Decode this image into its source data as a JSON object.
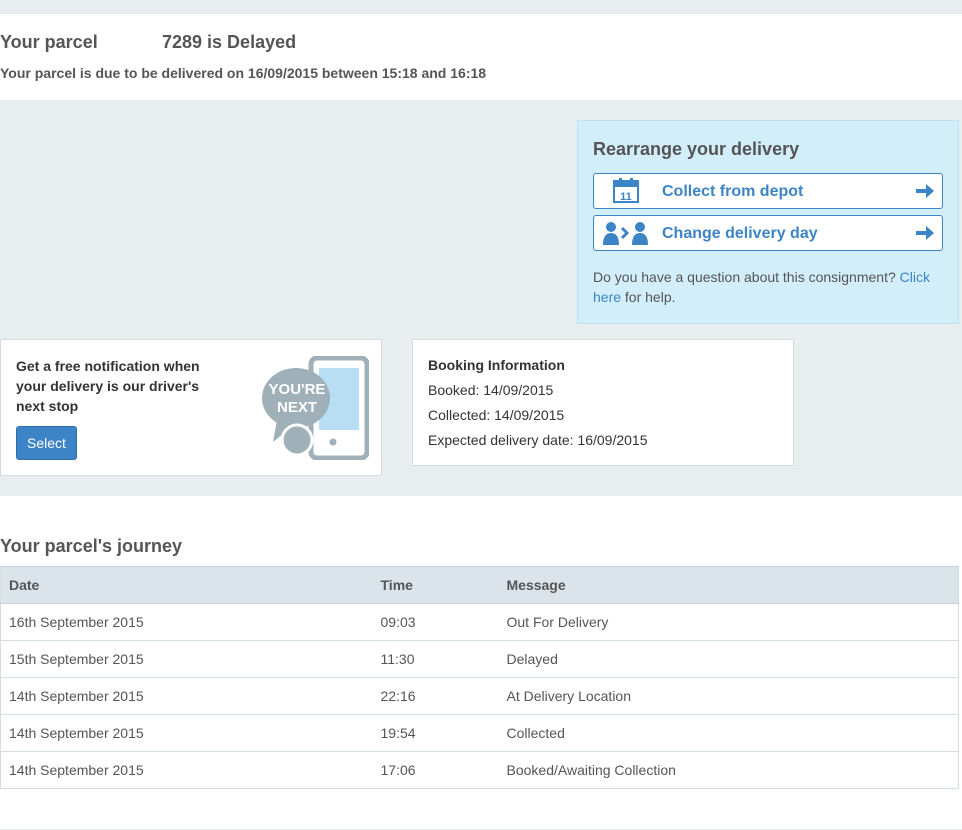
{
  "header": {
    "title_prefix": "Your parcel",
    "title_status": "7289 is Delayed",
    "subtitle": "Your parcel is due to be delivered on 16/09/2015 between 15:18 and 16:18"
  },
  "rearrange": {
    "heading": "Rearrange your delivery",
    "options": [
      {
        "label": "Collect from depot",
        "icon": "calendar-icon"
      },
      {
        "label": "Change delivery day",
        "icon": "people-swap-icon"
      }
    ],
    "help_text": "Do you have a question about this consignment?",
    "help_link": "Click here",
    "help_suffix": "for help."
  },
  "notification": {
    "text": "Get a free notification when your delivery is our driver's next stop",
    "button_label": "Select",
    "badge_line1": "YOU'RE",
    "badge_line2": "NEXT"
  },
  "booking": {
    "heading": "Booking Information",
    "booked": "Booked: 14/09/2015",
    "collected": "Collected: 14/09/2015",
    "expected": "Expected delivery date: 16/09/2015"
  },
  "journey": {
    "title": "Your parcel's journey",
    "columns": [
      "Date",
      "Time",
      "Message"
    ],
    "rows": [
      [
        "16th September 2015",
        "09:03",
        "Out For Delivery"
      ],
      [
        "15th September 2015",
        "11:30",
        "Delayed"
      ],
      [
        "14th September 2015",
        "22:16",
        "At Delivery Location"
      ],
      [
        "14th September 2015",
        "19:54",
        "Collected"
      ],
      [
        "14th September 2015",
        "17:06",
        "Booked/Awaiting Collection"
      ]
    ]
  },
  "colors": {
    "accent": "#3d84c6",
    "panel_bg": "#d2eefa",
    "page_grey": "#e8edf0"
  }
}
